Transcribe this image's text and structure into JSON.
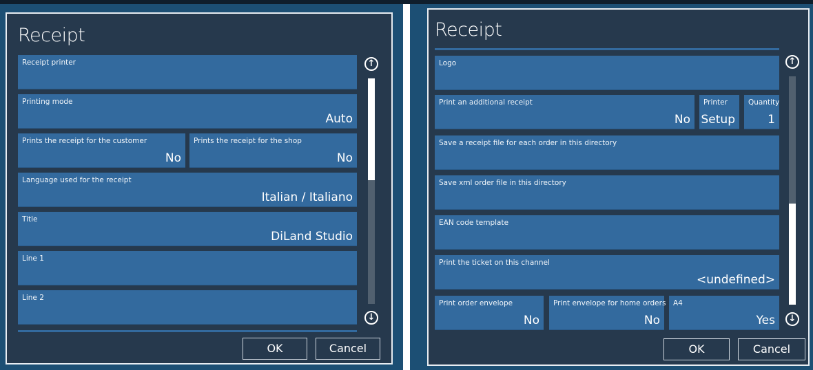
{
  "left": {
    "title": "Receipt",
    "fields": {
      "receipt_printer": {
        "label": "Receipt printer",
        "value": ""
      },
      "printing_mode": {
        "label": "Printing mode",
        "value": "Auto"
      },
      "customer_receipt": {
        "label": "Prints the receipt for the customer",
        "value": "No"
      },
      "shop_receipt": {
        "label": "Prints the receipt for the shop",
        "value": "No"
      },
      "language": {
        "label": "Language used for the receipt",
        "value": "Italian / Italiano"
      },
      "title": {
        "label": "Title",
        "value": "DiLand Studio"
      },
      "line1": {
        "label": "Line 1",
        "value": ""
      },
      "line2": {
        "label": "Line 2",
        "value": ""
      }
    },
    "buttons": {
      "ok": "OK",
      "cancel": "Cancel"
    },
    "scroll_position": 0
  },
  "right": {
    "title": "Receipt",
    "fields": {
      "logo": {
        "label": "Logo",
        "value": ""
      },
      "additional_receipt": {
        "label": "Print an additional receipt",
        "value": "No"
      },
      "printer": {
        "label": "Printer",
        "value": "Setup"
      },
      "quantity": {
        "label": "Quantity",
        "value": "1"
      },
      "receipt_dir": {
        "label": "Save a receipt file for each order in this directory",
        "value": ""
      },
      "xml_dir": {
        "label": "Save xml order file in this directory",
        "value": ""
      },
      "ean": {
        "label": "EAN code template",
        "value": ""
      },
      "ticket_channel": {
        "label": "Print the ticket on this channel",
        "value": "<undefined>"
      },
      "order_envelope": {
        "label": "Print order envelope",
        "value": "No"
      },
      "home_envelope": {
        "label": "Print envelope for home orders",
        "value": "No"
      },
      "a4": {
        "label": "A4",
        "value": "Yes"
      }
    },
    "buttons": {
      "ok": "OK",
      "cancel": "Cancel"
    },
    "scroll_position": 1
  },
  "icons": {
    "up": "arrow-up-circle-icon",
    "down": "arrow-down-circle-icon"
  },
  "colors": {
    "dialog_bg": "#26394d",
    "field_bg": "#336a9e",
    "background_app": "#1c4f74",
    "text": "#ffffff"
  }
}
